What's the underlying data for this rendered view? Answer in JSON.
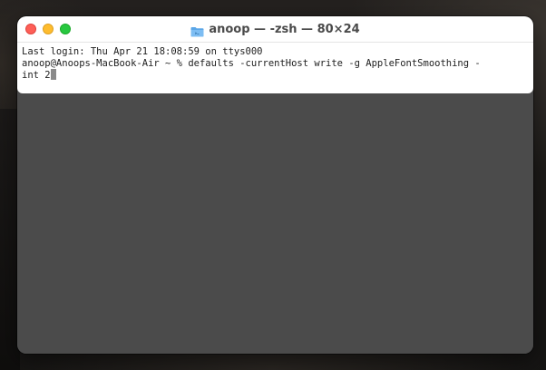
{
  "window": {
    "title": "anoop — -zsh — 80×24",
    "folder_icon": "folder-icon",
    "traffic_lights": {
      "close_color": "#fe5f57",
      "minimize_color": "#febc2e",
      "zoom_color": "#28c840"
    }
  },
  "terminal": {
    "lines": [
      "Last login: Thu Apr 21 18:08:59 on ttys000",
      "anoop@Anoops-MacBook-Air ~ % defaults -currentHost write -g AppleFontSmoothing -",
      "int 2"
    ]
  }
}
